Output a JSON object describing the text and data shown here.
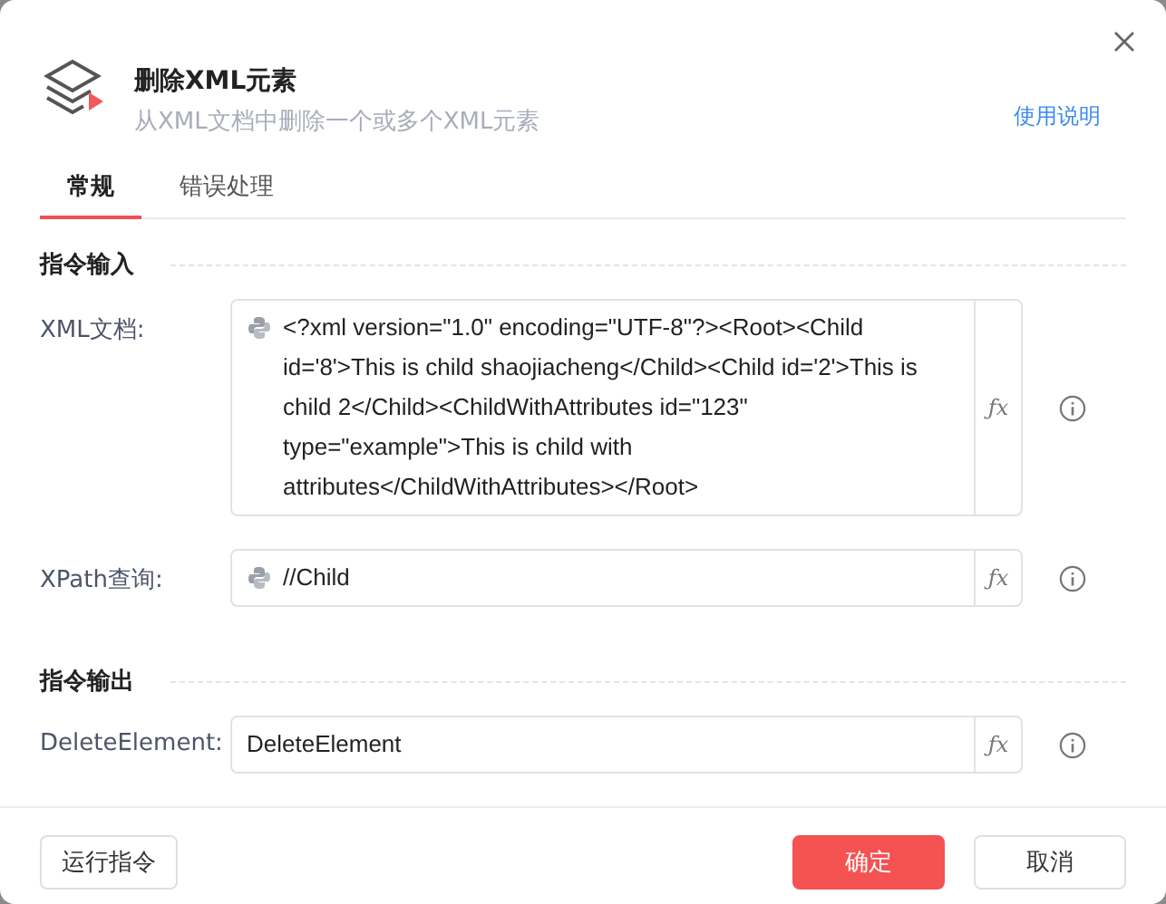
{
  "header": {
    "title": "删除XML元素",
    "subtitle": "从XML文档中删除一个或多个XML元素",
    "help_link": "使用说明"
  },
  "tabs": [
    {
      "label": "常规",
      "selected": true
    },
    {
      "label": "错误处理",
      "selected": false
    }
  ],
  "sections": [
    {
      "title": "指令输入",
      "fields": [
        {
          "label": "XML文档:",
          "kind": "python",
          "value": "<?xml version=\"1.0\" encoding=\"UTF-8\"?><Root><Child id='8'>This is child shaojiacheng</Child><Child id='2'>This is child 2</Child><ChildWithAttributes id=\"123\" type=\"example\">This is child with attributes</ChildWithAttributes></Root>",
          "formula": "ƒx"
        },
        {
          "label": "XPath查询:",
          "kind": "python",
          "value": "//Child",
          "formula": "ƒx"
        }
      ]
    },
    {
      "title": "指令输出",
      "fields": [
        {
          "label": "DeleteElement:",
          "kind": "plain",
          "value": "DeleteElement",
          "formula": "ƒx"
        }
      ]
    }
  ],
  "footer": {
    "run_button": "运行指令",
    "confirm_button": "确定",
    "cancel_button": "取消"
  }
}
